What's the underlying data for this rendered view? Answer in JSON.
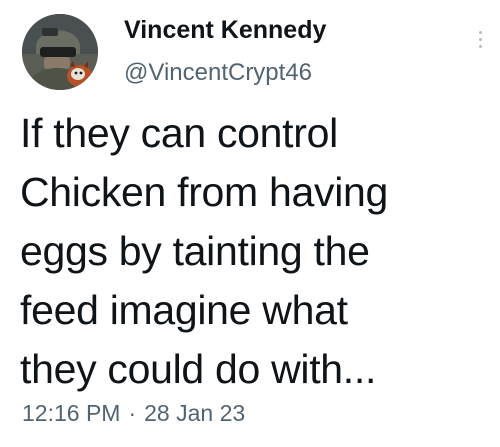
{
  "tweet": {
    "author": {
      "display_name": "Vincent Kennedy",
      "handle": "@VincentCrypt46",
      "avatar_icon": "profile-photo-helmet-soldier-with-red-panda"
    },
    "text_lines": [
      "If they can control",
      "Chicken from having",
      "eggs by tainting the",
      "feed imagine what",
      "they could do with..."
    ],
    "time": "12:16 PM",
    "separator": "·",
    "date": "28 Jan 23",
    "more_icon": "vertical-ellipsis-icon"
  },
  "colors": {
    "text_primary": "#0f1419",
    "text_secondary": "#536471",
    "background": "#ffffff"
  }
}
